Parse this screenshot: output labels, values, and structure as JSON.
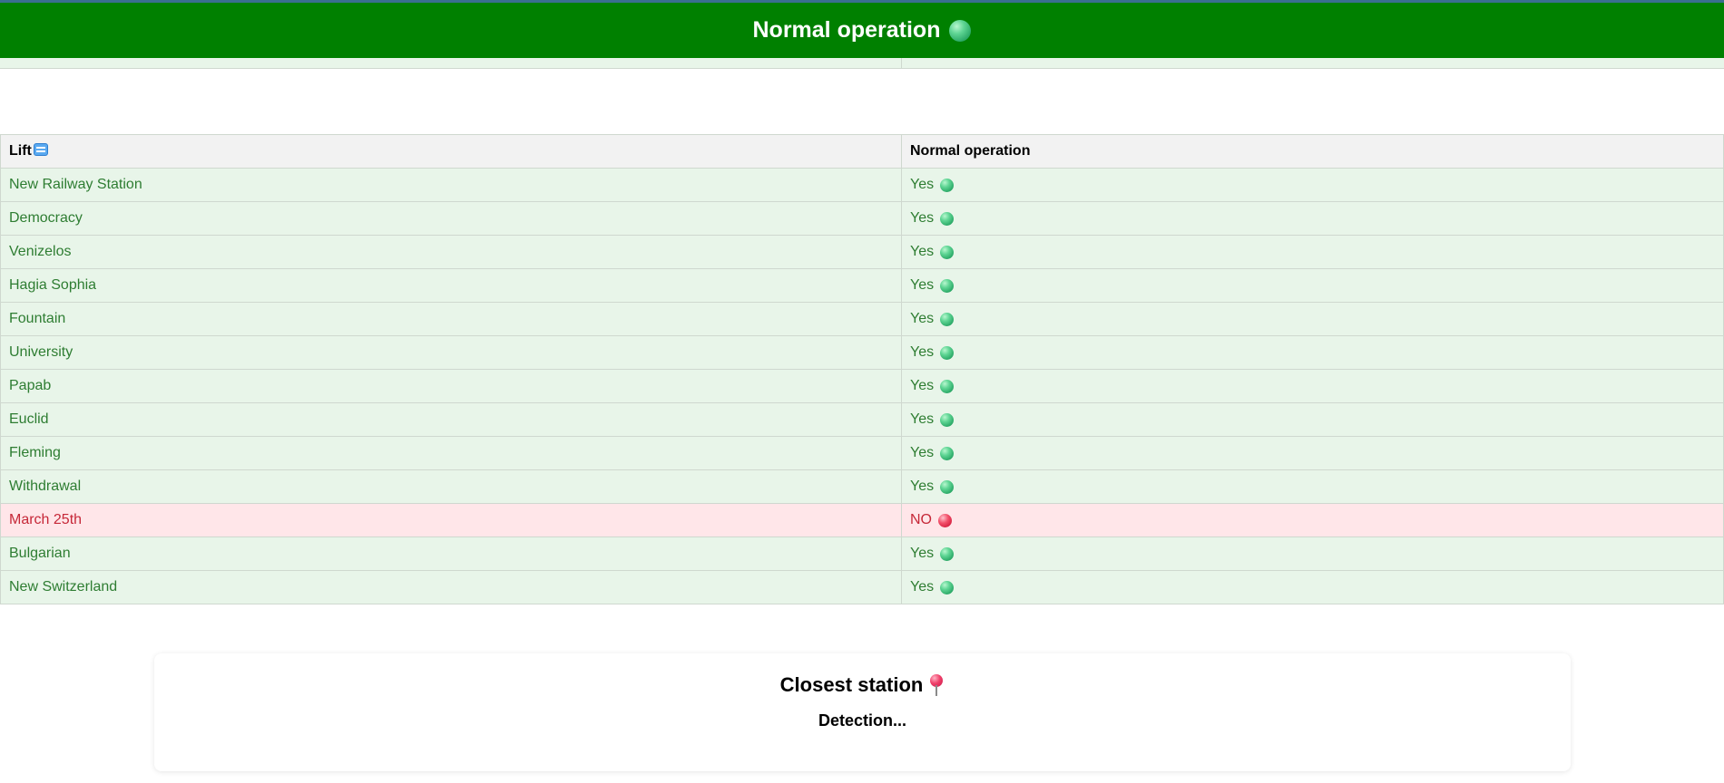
{
  "header": {
    "title": "Normal operation",
    "status_icon": "green-circle-icon",
    "background_color": "#008000"
  },
  "lifts_table": {
    "columns": [
      "Lift",
      "Normal operation"
    ],
    "header_icon": "elevator-icon",
    "rows": [
      {
        "name": "New Railway Station",
        "status": "Yes",
        "ok": true
      },
      {
        "name": "Democracy",
        "status": "Yes",
        "ok": true
      },
      {
        "name": "Venizelos",
        "status": "Yes",
        "ok": true
      },
      {
        "name": "Hagia Sophia",
        "status": "Yes",
        "ok": true
      },
      {
        "name": "Fountain",
        "status": "Yes",
        "ok": true
      },
      {
        "name": "University",
        "status": "Yes",
        "ok": true
      },
      {
        "name": "Papab",
        "status": "Yes",
        "ok": true
      },
      {
        "name": "Euclid",
        "status": "Yes",
        "ok": true
      },
      {
        "name": "Fleming",
        "status": "Yes",
        "ok": true
      },
      {
        "name": "Withdrawal",
        "status": "Yes",
        "ok": true
      },
      {
        "name": "March 25th",
        "status": "NO",
        "ok": false
      },
      {
        "name": "Bulgarian",
        "status": "Yes",
        "ok": true
      },
      {
        "name": "New Switzerland",
        "status": "Yes",
        "ok": true
      }
    ],
    "colors": {
      "ok_text": "#2e7d32",
      "ok_background": "#e8f5e9",
      "bad_text": "#c62838",
      "bad_background": "#ffe6e9"
    }
  },
  "closest_station": {
    "title": "Closest station",
    "icon": "pushpin-icon",
    "status": "Detection..."
  }
}
